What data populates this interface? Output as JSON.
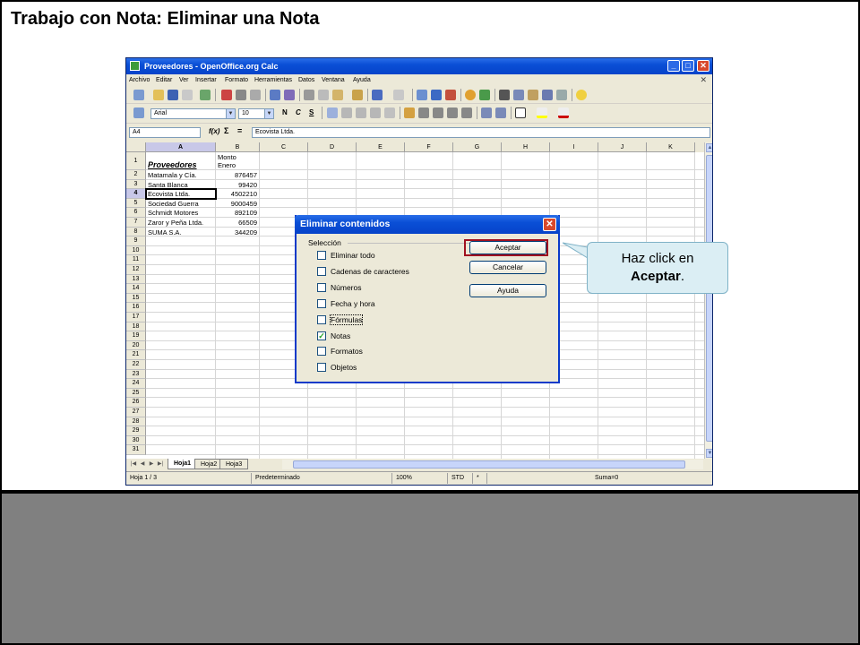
{
  "slide": {
    "title": "Trabajo con Nota: Eliminar una Nota"
  },
  "window": {
    "title": "Proveedores - OpenOffice.org Calc"
  },
  "menu": [
    "Archivo",
    "Editar",
    "Ver",
    "Insertar",
    "Formato",
    "Herramientas",
    "Datos",
    "Ventana",
    "Ayuda"
  ],
  "toolbar": {
    "font_name": "Arial",
    "font_size": "10",
    "bold": "N",
    "italic": "C",
    "underline": "S"
  },
  "formula_bar": {
    "name_box": "A4",
    "fx": "f(x)",
    "sigma": "Σ",
    "equals": "=",
    "content": "Ecovista Ltda."
  },
  "grid": {
    "columns": [
      "A",
      "B",
      "C",
      "D",
      "E",
      "F",
      "G",
      "H",
      "I",
      "J",
      "K"
    ],
    "rows": [
      "1",
      "2",
      "3",
      "4",
      "5",
      "6",
      "7",
      "8",
      "9",
      "10",
      "11",
      "12",
      "13",
      "14",
      "15",
      "16",
      "17",
      "18",
      "19",
      "20",
      "21",
      "22",
      "23",
      "24",
      "25",
      "26",
      "27",
      "28",
      "29",
      "30",
      "31"
    ],
    "header_a1": "Proveedores",
    "header_b1_line1": "Monto",
    "header_b1_line2": "Enero",
    "data": [
      {
        "name": "Matamala y Cía.",
        "amount": "876457"
      },
      {
        "name": "Santa Blanca",
        "amount": "99420"
      },
      {
        "name": "Ecovista Ltda.",
        "amount": "4502210"
      },
      {
        "name": "Sociedad Guerra",
        "amount": "9000459"
      },
      {
        "name": "Schmidt Motores",
        "amount": "892109"
      },
      {
        "name": "Zaror y Peña Ltda.",
        "amount": "66509"
      },
      {
        "name": "SUMA S.A.",
        "amount": "344209"
      }
    ]
  },
  "sheet_tabs": [
    "Hoja1",
    "Hoja2",
    "Hoja3"
  ],
  "status_bar": {
    "sheet": "Hoja 1 / 3",
    "style": "Predeterminado",
    "zoom": "100%",
    "mode": "STD",
    "modified": "*",
    "sum": "Suma=0"
  },
  "dialog": {
    "title": "Eliminar contenidos",
    "section": "Selección",
    "options": [
      {
        "label": "Eliminar todo",
        "checked": false
      },
      {
        "label": "Cadenas de caracteres",
        "checked": false
      },
      {
        "label": "Números",
        "checked": false
      },
      {
        "label": "Fecha y hora",
        "checked": false
      },
      {
        "label": "Fórmulas",
        "checked": false
      },
      {
        "label": "Notas",
        "checked": true
      },
      {
        "label": "Formatos",
        "checked": false
      },
      {
        "label": "Objetos",
        "checked": false
      }
    ],
    "buttons": {
      "accept": "Aceptar",
      "cancel": "Cancelar",
      "help": "Ayuda"
    }
  },
  "callout": {
    "text": "Haz click en",
    "emphasis": "Aceptar",
    "suffix": "."
  }
}
